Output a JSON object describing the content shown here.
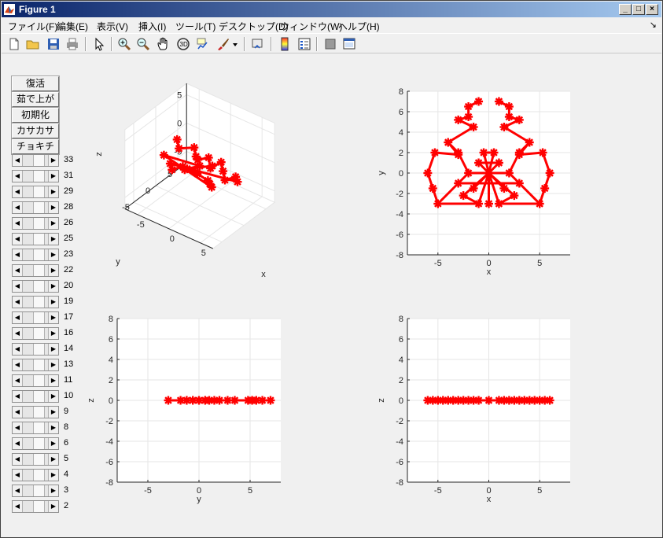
{
  "window": {
    "title": "Figure 1",
    "minimize_glyph": "_",
    "maximize_glyph": "□",
    "close_glyph": "×"
  },
  "menubar": {
    "items": [
      {
        "label": "ファイル(F)"
      },
      {
        "label": "編集(E)"
      },
      {
        "label": "表示(V)"
      },
      {
        "label": "挿入(I)"
      },
      {
        "label": "ツール(T)"
      },
      {
        "label": "デスクトップ(D)"
      },
      {
        "label": "ウィンドウ(W)"
      },
      {
        "label": "ヘルプ(H)"
      }
    ],
    "dock_glyph": "↘"
  },
  "toolbar": {
    "icons": [
      "new-figure-icon",
      "open-file-icon",
      "save-icon",
      "print-icon",
      "pointer-icon",
      "zoom-in-icon",
      "zoom-out-icon",
      "pan-hand-icon",
      "rotate-3d-icon",
      "data-cursor-icon",
      "brush-icon",
      "brush-dropdown-icon",
      "link-plot-icon",
      "colorbar-icon",
      "legend-icon",
      "hide-plot-tools-icon",
      "show-plot-tools-icon"
    ]
  },
  "panel": {
    "buttons": [
      "復活",
      "茹で上がり",
      "初期化",
      "カサカサ",
      "チョキチョキ"
    ],
    "slider_labels": [
      "33",
      "31",
      "29",
      "28",
      "26",
      "25",
      "23",
      "22",
      "20",
      "19",
      "17",
      "16",
      "14",
      "13",
      "11",
      "10",
      "9",
      "8",
      "6",
      "5",
      "4",
      "3",
      "2"
    ],
    "arrow_left": "◀",
    "arrow_right": "▶"
  },
  "colors": {
    "marker": "#ff0000",
    "axes_bg": "#ffffff",
    "figure_bg": "#f0f0f0",
    "grid": "#e6e6e6",
    "title_grad_start": "#0a246a",
    "title_grad_end": "#a6caf0"
  },
  "chart_data": [
    {
      "type": "scatter-3d",
      "xlabel": "x",
      "ylabel": "y",
      "zlabel": "z",
      "xticks": [
        "-5",
        "0",
        "5"
      ],
      "yticks": [
        "5",
        "0",
        "-5"
      ],
      "zticks": [
        "5",
        "0",
        "-5"
      ],
      "grid": true,
      "marker": "*",
      "view": "default 3d (az -37.5, el 30)"
    },
    {
      "type": "scatter",
      "xlabel": "x",
      "ylabel": "y",
      "xlim": [
        -8,
        8
      ],
      "ylim": [
        -8,
        8
      ],
      "xticks": [
        "-5",
        "0",
        "5"
      ],
      "yticks": [
        "8",
        "6",
        "4",
        "2",
        "0",
        "-2",
        "-4",
        "-6",
        "-8"
      ],
      "grid": true,
      "marker": "*",
      "points": [
        [
          -1,
          7
        ],
        [
          -2,
          6.5
        ],
        [
          -2,
          5.5
        ],
        [
          -3,
          5.2
        ],
        [
          -1.5,
          4.5
        ],
        [
          -4,
          3
        ],
        [
          -3,
          1.8
        ],
        [
          -5.3,
          2
        ],
        [
          -6,
          0
        ],
        [
          -5.5,
          -1.5
        ],
        [
          -5,
          -3
        ],
        [
          -3,
          -1
        ],
        [
          -2,
          0
        ],
        [
          -3,
          2
        ],
        [
          1,
          7
        ],
        [
          2,
          6.5
        ],
        [
          2,
          5.5
        ],
        [
          3,
          5.2
        ],
        [
          1.5,
          4.5
        ],
        [
          4,
          3
        ],
        [
          3,
          1.8
        ],
        [
          5.3,
          2
        ],
        [
          6,
          0
        ],
        [
          5.5,
          -1.5
        ],
        [
          5,
          -3
        ],
        [
          3,
          -1
        ],
        [
          2,
          0
        ],
        [
          3,
          2
        ],
        [
          0,
          0
        ],
        [
          0,
          -3
        ],
        [
          1,
          -3
        ],
        [
          -1,
          -3
        ],
        [
          -1.5,
          -1.5
        ],
        [
          1.5,
          -1.5
        ],
        [
          -0.5,
          2
        ],
        [
          0.5,
          2
        ],
        [
          1,
          1
        ],
        [
          -1,
          1
        ],
        [
          -2.5,
          -2.2
        ],
        [
          2.5,
          -2.2
        ]
      ],
      "links": [
        [
          0,
          1
        ],
        [
          1,
          2
        ],
        [
          2,
          3
        ],
        [
          3,
          4
        ],
        [
          4,
          5
        ],
        [
          5,
          6
        ],
        [
          6,
          7
        ],
        [
          7,
          8
        ],
        [
          8,
          9
        ],
        [
          9,
          10
        ],
        [
          5,
          13
        ],
        [
          13,
          12
        ],
        [
          12,
          11
        ],
        [
          11,
          10
        ],
        [
          14,
          15
        ],
        [
          15,
          16
        ],
        [
          16,
          17
        ],
        [
          17,
          18
        ],
        [
          18,
          19
        ],
        [
          19,
          20
        ],
        [
          20,
          21
        ],
        [
          21,
          22
        ],
        [
          22,
          23
        ],
        [
          23,
          24
        ],
        [
          19,
          27
        ],
        [
          27,
          26
        ],
        [
          26,
          25
        ],
        [
          25,
          24
        ],
        [
          28,
          29
        ],
        [
          28,
          30
        ],
        [
          28,
          31
        ],
        [
          28,
          32
        ],
        [
          28,
          33
        ],
        [
          28,
          34
        ],
        [
          28,
          35
        ],
        [
          28,
          36
        ],
        [
          28,
          37
        ],
        [
          28,
          38
        ],
        [
          28,
          39
        ],
        [
          6,
          13
        ],
        [
          20,
          27
        ],
        [
          34,
          35
        ],
        [
          36,
          37
        ],
        [
          12,
          26
        ],
        [
          11,
          25
        ],
        [
          10,
          31
        ],
        [
          24,
          30
        ],
        [
          38,
          31
        ],
        [
          39,
          30
        ]
      ]
    },
    {
      "type": "scatter",
      "xlabel": "y",
      "ylabel": "z",
      "xlim": [
        -8,
        8
      ],
      "ylim": [
        -8,
        8
      ],
      "xticks": [
        "-5",
        "0",
        "5"
      ],
      "yticks": [
        "8",
        "6",
        "4",
        "2",
        "0",
        "-2",
        "-4",
        "-6",
        "-8"
      ],
      "grid": true,
      "marker": "*",
      "x": [
        -3,
        -1.8,
        -1.2,
        -0.6,
        0,
        0.6,
        1,
        1.5,
        2,
        2.8,
        3.5,
        4.8,
        5.2,
        5.6,
        6.2,
        7
      ],
      "y": [
        0,
        0,
        0,
        0,
        0,
        0,
        0,
        0,
        0,
        0,
        0,
        0,
        0,
        0,
        0,
        0
      ]
    },
    {
      "type": "scatter",
      "xlabel": "x",
      "ylabel": "z",
      "xlim": [
        -8,
        8
      ],
      "ylim": [
        -8,
        8
      ],
      "xticks": [
        "-5",
        "0",
        "5"
      ],
      "yticks": [
        "8",
        "6",
        "4",
        "2",
        "0",
        "-2",
        "-4",
        "-6",
        "-8"
      ],
      "grid": true,
      "marker": "*",
      "x": [
        -6,
        -5.5,
        -5,
        -4.5,
        -4,
        -3.5,
        -3,
        -2.5,
        -2,
        -1.5,
        -1,
        0,
        1,
        1.5,
        2,
        2.5,
        3,
        3.5,
        4,
        4.5,
        5,
        5.5,
        6
      ],
      "y": [
        0,
        0,
        0,
        0,
        0,
        0,
        0,
        0,
        0,
        0,
        0,
        0,
        0,
        0,
        0,
        0,
        0,
        0,
        0,
        0,
        0,
        0,
        0
      ]
    }
  ]
}
